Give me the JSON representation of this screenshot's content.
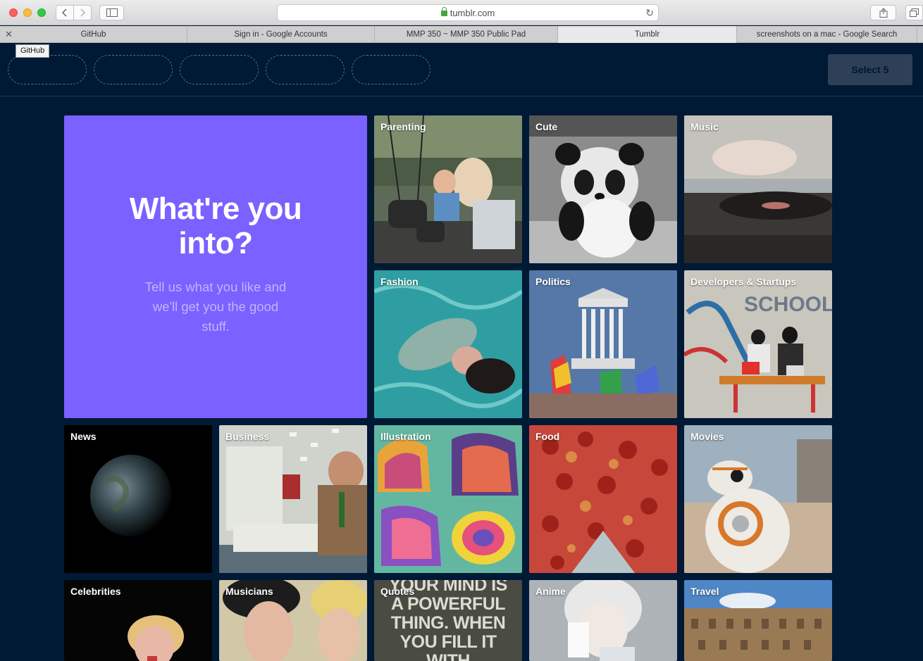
{
  "browser": {
    "url": "tumblr.com",
    "tabs": [
      {
        "label": "GitHub",
        "active": false
      },
      {
        "label": "Sign in - Google Accounts",
        "active": false
      },
      {
        "label": "MMP 350 ~ MMP 350 Public Pad",
        "active": false
      },
      {
        "label": "Tumblr",
        "active": true
      },
      {
        "label": "screenshots on a mac - Google Search",
        "active": false
      }
    ],
    "tooltip": "GitHub"
  },
  "header": {
    "select_button": "Select 5",
    "slot_count": 5
  },
  "hero": {
    "title": "What're you into?",
    "subtitle": "Tell us what you like and we'll get you the good stuff."
  },
  "categories": [
    {
      "label": "Parenting",
      "image": "family-swing-photo"
    },
    {
      "label": "Cute",
      "image": "panda-photo"
    },
    {
      "label": "Music",
      "image": "record-player-photo"
    },
    {
      "label": "Fashion",
      "image": "pool-fashion-photo"
    },
    {
      "label": "Politics",
      "image": "supreme-court-photo"
    },
    {
      "label": "Developers & Startups",
      "image": "flatiron-school-photo"
    },
    {
      "label": "News",
      "image": "earth-photo"
    },
    {
      "label": "Business",
      "image": "office-cartoon-photo"
    },
    {
      "label": "Illustration",
      "image": "abstract-art-photo"
    },
    {
      "label": "Food",
      "image": "pizza-photo"
    },
    {
      "label": "Movies",
      "image": "bb8-photo"
    },
    {
      "label": "Celebrities",
      "image": "celebrity-photo"
    },
    {
      "label": "Musicians",
      "image": "band-photo"
    },
    {
      "label": "Quotes",
      "image": "quote-poster-photo",
      "poster_text": "YOUR MIND IS A POWERFUL THING. WHEN YOU FILL IT WITH POSITIVE"
    },
    {
      "label": "Anime",
      "image": "anime-character-photo"
    },
    {
      "label": "Travel",
      "image": "colosseum-photo"
    }
  ]
}
